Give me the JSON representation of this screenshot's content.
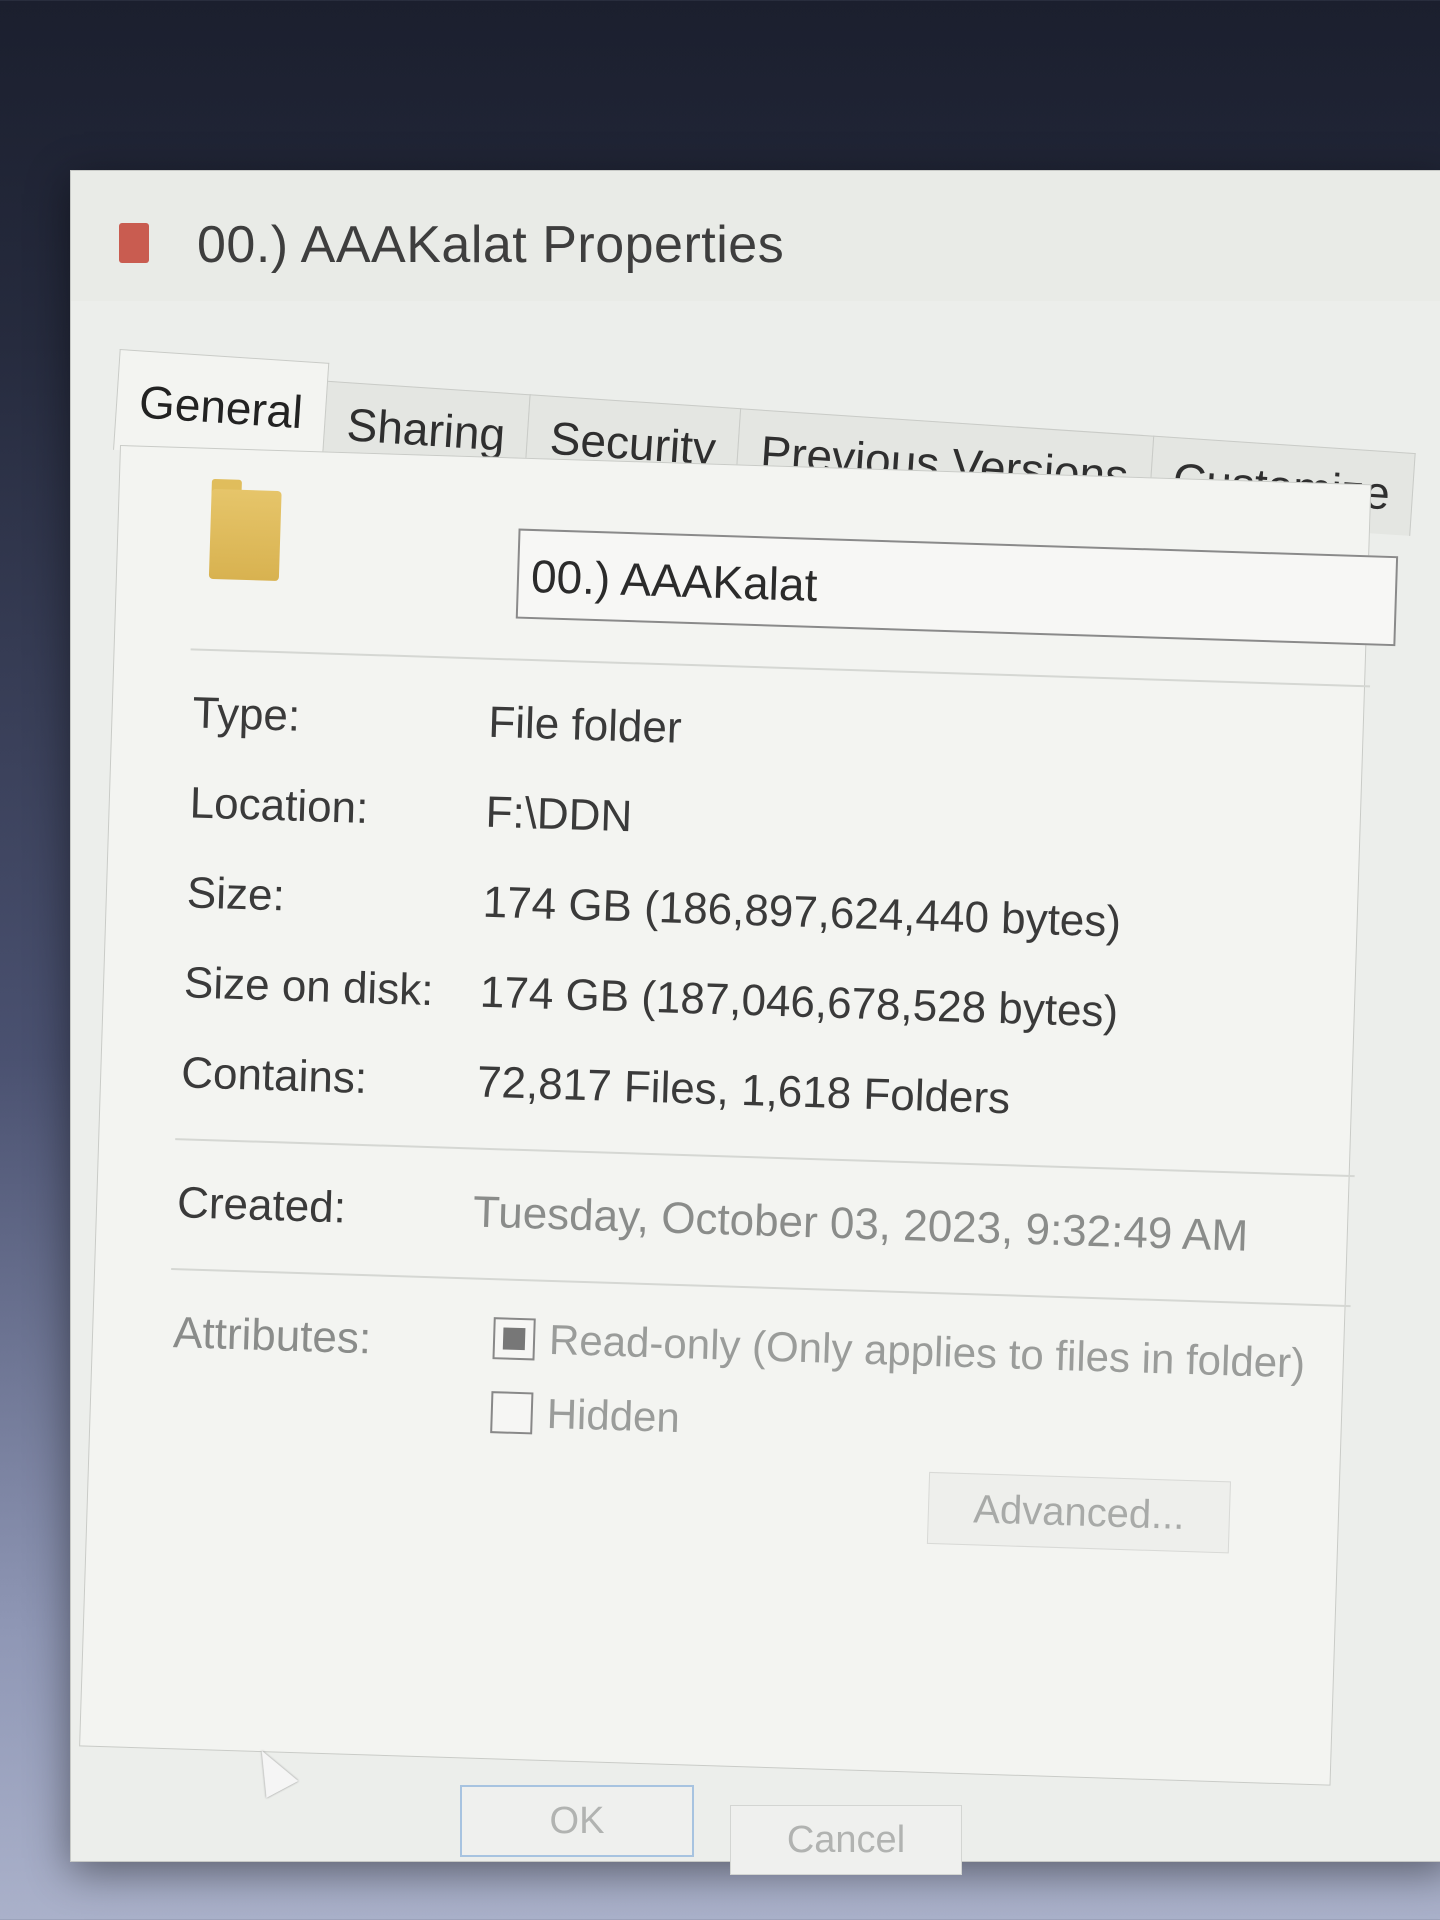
{
  "window": {
    "title": "00.) AAAKalat Properties"
  },
  "tabs": [
    {
      "label": "General",
      "active": true
    },
    {
      "label": "Sharing",
      "active": false
    },
    {
      "label": "Security",
      "active": false
    },
    {
      "label": "Previous Versions",
      "active": false
    },
    {
      "label": "Customize",
      "active": false
    }
  ],
  "general": {
    "folder_name": "00.) AAAKalat",
    "type_label": "Type:",
    "type_value": "File folder",
    "location_label": "Location:",
    "location_value": "F:\\DDN",
    "size_label": "Size:",
    "size_value": "174 GB (186,897,624,440 bytes)",
    "size_on_disk_label": "Size on disk:",
    "size_on_disk_value": "174 GB (187,046,678,528 bytes)",
    "contains_label": "Contains:",
    "contains_value": "72,817 Files, 1,618 Folders",
    "created_label": "Created:",
    "created_value": "Tuesday, October 03, 2023, 9:32:49 AM",
    "attributes_label": "Attributes:",
    "readonly_label": "Read-only (Only applies to files in folder)",
    "readonly_state": "indeterminate",
    "hidden_label": "Hidden",
    "hidden_state": "unchecked",
    "advanced_label": "Advanced..."
  },
  "footer": {
    "ok_label": "OK",
    "cancel_label": "Cancel"
  },
  "icons": {
    "title": "folder-properties-icon",
    "folder": "folder-icon",
    "cursor": "mouse-cursor-icon"
  },
  "colors": {
    "dialog_background": "#eceeeb",
    "folder": "#d8b250",
    "ok_border": "#a7c3e0"
  }
}
